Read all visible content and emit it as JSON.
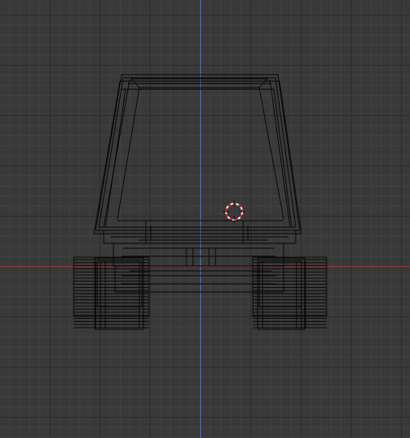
{
  "viewport": {
    "view": "front-orthographic",
    "shading": "wireframe",
    "background_color": "#393939",
    "grid_minor_color": "#434343",
    "grid_major_color": "#2c2c2c",
    "x_axis_color": "#8a3a3c",
    "z_axis_color": "#4f6fa8",
    "wire_color": "#000000",
    "cursor_icon": "3d-cursor-icon"
  }
}
